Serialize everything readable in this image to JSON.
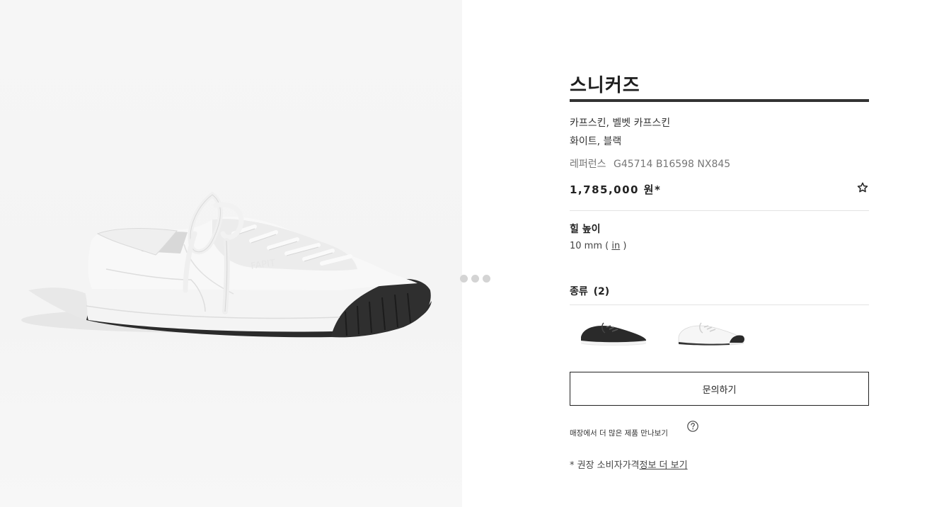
{
  "product": {
    "title": "스니커즈",
    "material": "카프스킨, 벨벳 카프스킨",
    "color": "화이트, 블랙",
    "reference_label": "레퍼런스",
    "reference_code": "G45714 B16598 NX845",
    "price": "1,785,000 원*"
  },
  "gallery": {
    "slide_count": 3,
    "active_slide": 1,
    "shoe_brand_emboss": "FAPIT"
  },
  "specs": {
    "heel_label": "힐 높이",
    "heel_value_prefix": "10 mm (",
    "heel_unit_link": "in",
    "heel_value_suffix": ")"
  },
  "variants": {
    "label": "종류",
    "count": "(2)",
    "items": [
      {
        "color_name": "black",
        "body_color": "#2a2a2a"
      },
      {
        "color_name": "white",
        "body_color": "#f2f2f2"
      }
    ]
  },
  "actions": {
    "inquiry_label": "문의하기",
    "store_link": "매장에서 더 많은 제품 만나보기",
    "footnote_prefix": "* 권장 소비자가격",
    "footnote_link": "정보 더 보기"
  },
  "icons": {
    "wishlist": "star-outline-icon",
    "help": "question-circle-icon"
  },
  "colors": {
    "text": "#222222",
    "rule": "#333333",
    "divider": "#e3e3e3",
    "pager_dot": "#d4d4d4"
  }
}
